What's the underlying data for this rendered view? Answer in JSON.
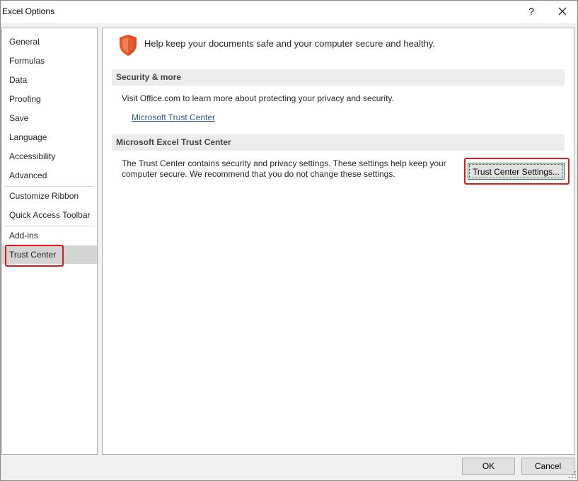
{
  "window": {
    "title": "Excel Options",
    "help_label": "?"
  },
  "nav": {
    "items": [
      {
        "label": "General"
      },
      {
        "label": "Formulas"
      },
      {
        "label": "Data"
      },
      {
        "label": "Proofing"
      },
      {
        "label": "Save"
      },
      {
        "label": "Language"
      },
      {
        "label": "Accessibility"
      },
      {
        "label": "Advanced"
      },
      {
        "label": "Customize Ribbon"
      },
      {
        "label": "Quick Access Toolbar"
      },
      {
        "label": "Add-ins"
      },
      {
        "label": "Trust Center"
      }
    ],
    "selected": "Trust Center"
  },
  "main": {
    "header": "Help keep your documents safe and your computer secure and healthy.",
    "security_section": {
      "title": "Security & more",
      "description": "Visit Office.com to learn more about protecting your privacy and security.",
      "link": "Microsoft Trust Center"
    },
    "trust_center_section": {
      "title": "Microsoft Excel Trust Center",
      "description_line1": "The Trust Center contains security and privacy settings. These settings help keep your",
      "description_line2": "computer secure. We recommend that you do not change these settings.",
      "button_label": "Trust Center Settings..."
    }
  },
  "footer": {
    "ok_label": "OK",
    "cancel_label": "Cancel"
  },
  "colors": {
    "highlight": "#e0161b",
    "link": "#2b579a",
    "shield": "#e8582a",
    "selected_nav": "#d4d4d4"
  },
  "icons": [
    "close-icon",
    "shield-icon",
    "resize-grip-icon"
  ]
}
